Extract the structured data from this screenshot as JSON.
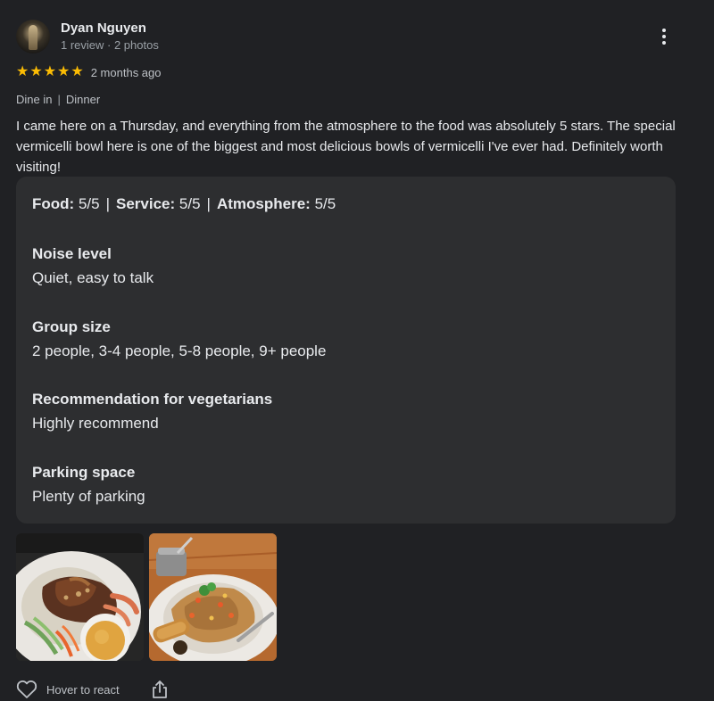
{
  "author": {
    "name": "Dyan Nguyen",
    "meta": "1 review · 2 photos"
  },
  "rating": {
    "stars": 5,
    "time_ago": "2 months ago"
  },
  "visit": {
    "service_type": "Dine in",
    "separator": "|",
    "meal_type": "Dinner"
  },
  "review_text": "I came here on a Thursday, and everything from the atmosphere to the food was absolutely 5 stars. The special vermicelli bowl here is one of the biggest and most delicious bowls of vermicelli I've ever had. Definitely worth visiting!",
  "scores": {
    "food_label": "Food:",
    "food_value": "5/5",
    "service_label": "Service:",
    "service_value": "5/5",
    "atmosphere_label": "Atmosphere:",
    "atmosphere_value": "5/5",
    "separator": "|"
  },
  "attributes": [
    {
      "label": "Noise level",
      "value": "Quiet, easy to talk"
    },
    {
      "label": "Group size",
      "value": "2 people, 3-4 people, 5-8 people, 9+ people"
    },
    {
      "label": "Recommendation for vegetarians",
      "value": "Highly recommend"
    },
    {
      "label": "Parking space",
      "value": "Plenty of parking"
    }
  ],
  "photos": [
    {
      "subject": "vermicelli bowl with grilled beef, shrimp and dipping sauce"
    },
    {
      "subject": "fried rice plate with spring roll on wooden table"
    }
  ],
  "actions": {
    "react_label": "Hover to react",
    "react_icon": "heart-outline-icon",
    "share_icon": "share-icon",
    "more_icon": "more-vert-icon"
  },
  "colors": {
    "background": "#202124",
    "card": "#2d2e30",
    "star": "#fbbc04"
  }
}
